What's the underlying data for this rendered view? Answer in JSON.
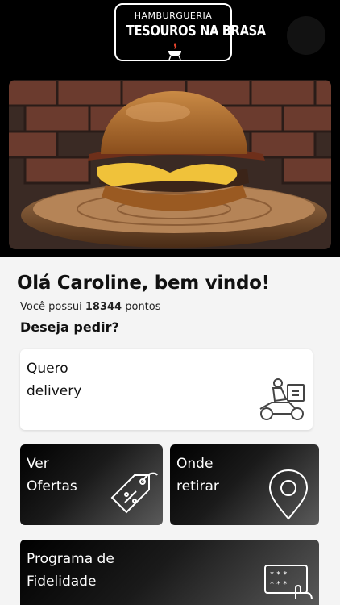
{
  "brand": {
    "subtitle": "HAMBURGUERIA",
    "name": "TESOUROS NA BRASA"
  },
  "greeting": {
    "title": "Olá Caroline, bem vindo!",
    "points_prefix": "Você possui",
    "points_value": "18344",
    "points_suffix": "pontos",
    "question": "Deseja pedir?"
  },
  "cards": {
    "delivery": {
      "line1": "Quero",
      "line2": "delivery",
      "icon": "delivery-scooter-icon"
    },
    "offers": {
      "line1": "Ver",
      "line2": "Ofertas",
      "icon": "price-tag-icon"
    },
    "pickup": {
      "line1": "Onde",
      "line2": "retirar",
      "icon": "location-pin-icon"
    },
    "loyalty": {
      "line1": "Programa de",
      "line2": "Fidelidade",
      "icon": "loyalty-card-icon"
    }
  },
  "colors": {
    "header_bg": "#000000",
    "content_bg": "#f4f4f4",
    "card_light": "#ffffff",
    "card_dark": "#1a1a1a"
  }
}
